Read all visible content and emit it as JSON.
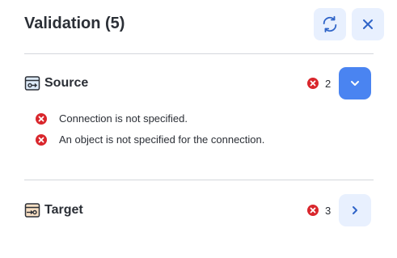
{
  "panel": {
    "title": "Validation (5)"
  },
  "sections": [
    {
      "label": "Source",
      "error_count": "2",
      "expanded": true,
      "icon": "source-object-icon",
      "errors": [
        "Connection is not specified.",
        "An object is not specified for the connection."
      ]
    },
    {
      "label": "Target",
      "error_count": "3",
      "expanded": false,
      "icon": "target-object-icon"
    }
  ],
  "colors": {
    "accent": "#4a84f1",
    "button_bg": "#e8f0fe",
    "error": "#d9262c",
    "text": "#2b2f36",
    "divider": "#d4d7dc"
  },
  "icons": {
    "refresh": "refresh-icon",
    "close": "close-icon",
    "error": "error-x-icon",
    "expand": "chevron-down-icon",
    "collapse": "chevron-right-icon"
  }
}
